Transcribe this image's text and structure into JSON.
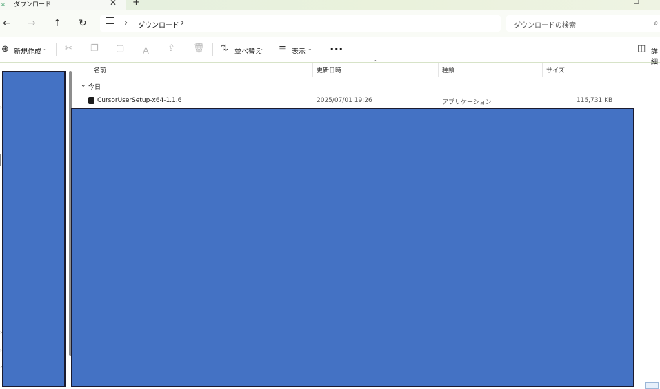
{
  "window": {
    "tab_title": "ダウンロード",
    "tab_close_glyph": "✕",
    "new_tab_glyph": "+",
    "minimize_glyph": "—",
    "maximize_glyph": "◻"
  },
  "nav": {
    "back_glyph": "←",
    "forward_glyph": "→",
    "up_glyph": "↑",
    "refresh_glyph": "↻"
  },
  "address": {
    "separator": "›",
    "crumbs": [
      "ダウンロード"
    ],
    "trailing_separator": "›"
  },
  "search": {
    "placeholder": "ダウンロードの検索",
    "icon": "search-icon",
    "icon_glyph": "⌕"
  },
  "toolbar": {
    "new_label": "新規作成",
    "new_icon_glyph": "⊕",
    "cut_glyph": "✂",
    "copy_glyph": "❐",
    "paste_glyph": "▢",
    "rename_glyph": "Ａ",
    "share_glyph": "⇪",
    "delete_glyph": "🗑",
    "sort_label": "並べ替え",
    "sort_icon_glyph": "⇅",
    "view_label": "表示",
    "view_icon_glyph": "≡",
    "more_glyph": "•••",
    "details_label": "詳細",
    "details_icon_glyph": "◫",
    "dropdown_glyph": "⌄"
  },
  "columns": {
    "name": "名前",
    "modified": "更新日時",
    "type": "種類",
    "size": "サイズ",
    "sort_glyph": "⌃"
  },
  "group": {
    "label": "今日",
    "chevron_glyph": "⌄"
  },
  "files": [
    {
      "name": "CursorUserSetup-x64-1.1.6",
      "modified": "2025/07/01 19:26",
      "type": "アプリケーション",
      "size": "115,731 KB"
    }
  ],
  "colors": {
    "redaction": "#4472c4",
    "accent": "#1f8f52",
    "titlebar": "#e4efe0"
  },
  "left_chevron_glyph": "›"
}
